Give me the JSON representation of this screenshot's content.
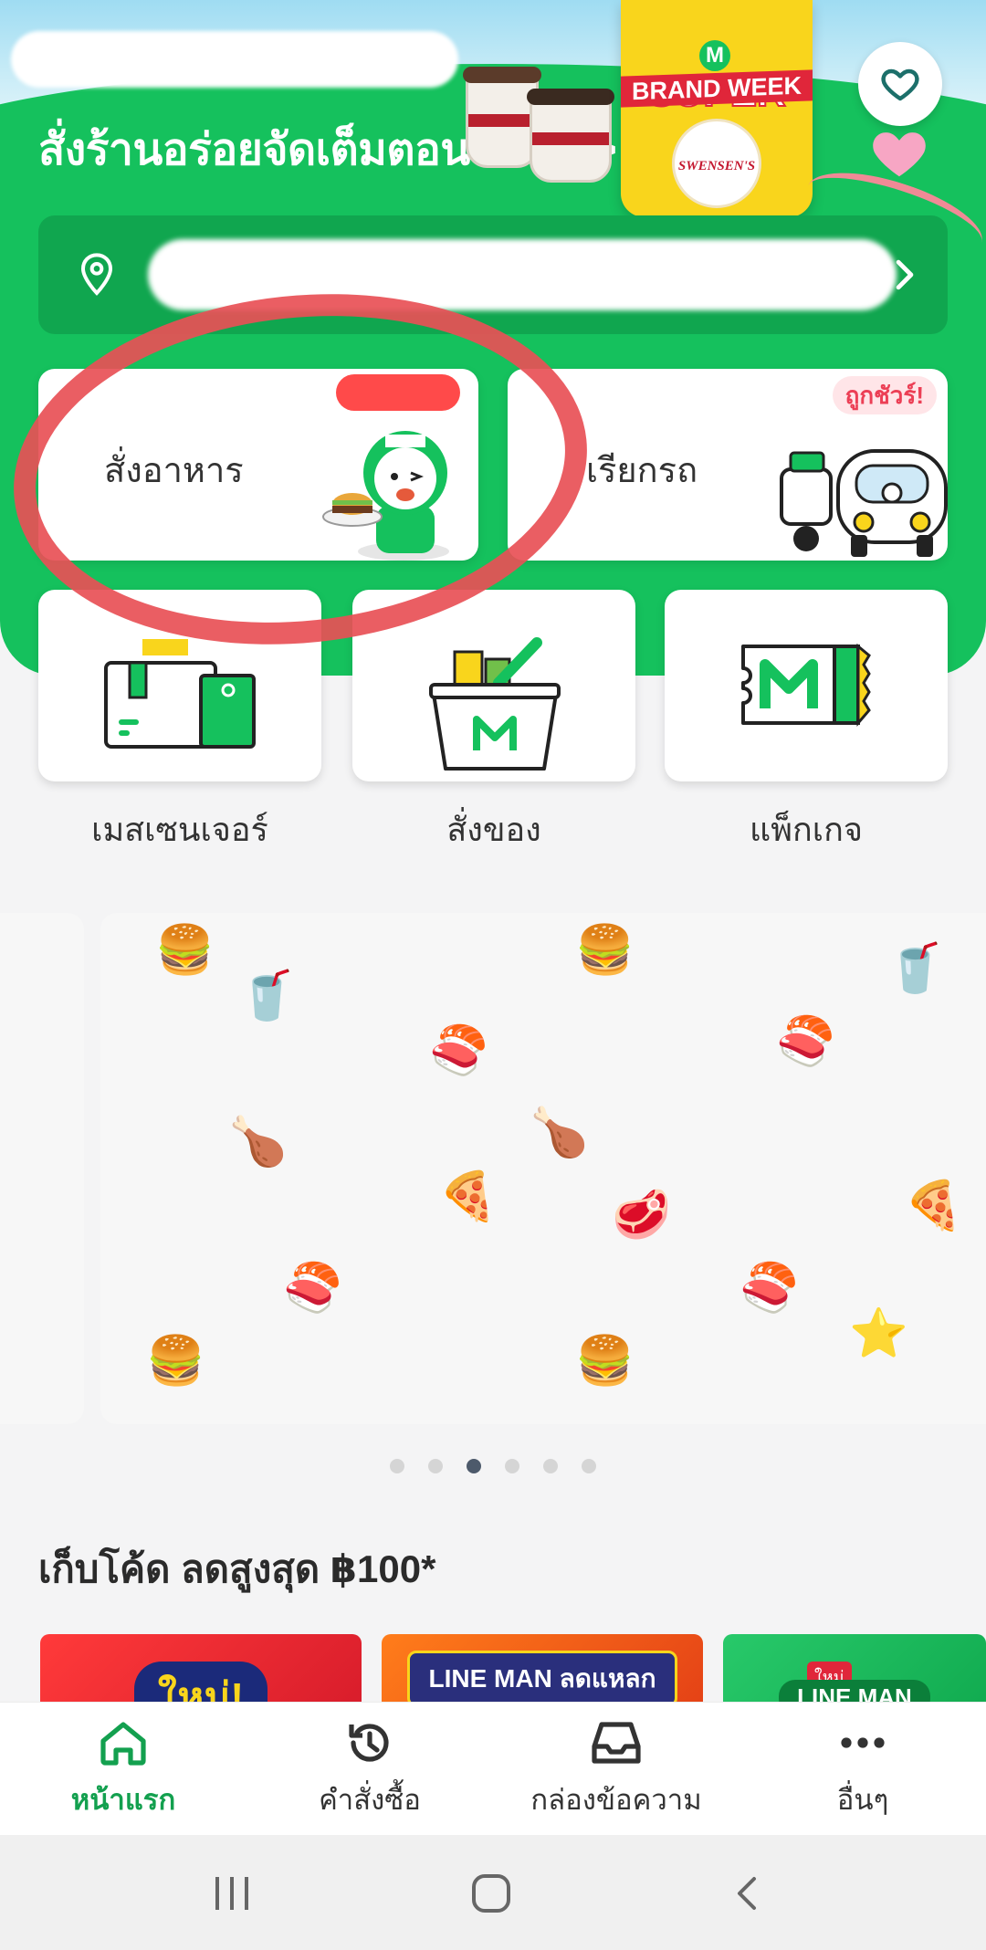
{
  "hero": {
    "headline": "สั่งร้านอร่อยจัดเต็มตอนนี้เลย! >",
    "promo": {
      "brand_mark": "M",
      "line1": "SUPER",
      "line2": "BRAND WEEK",
      "logo_text": "SWENSEN'S"
    },
    "favorite_icon": "heart-icon"
  },
  "address_bar": {
    "pin_icon": "location-pin-icon",
    "chevron_icon": "chevron-right-icon"
  },
  "services": [
    {
      "label": "สั่งอาหาร",
      "tag": "",
      "icon": "rider-with-burger"
    },
    {
      "label": "เรียกรถ",
      "tag": "ถูกชัวร์!",
      "icon": "motorbike-and-car"
    }
  ],
  "tiles": [
    {
      "label": "เมสเซนเจอร์",
      "icon": "parcel-icon"
    },
    {
      "label": "สั่งของ",
      "icon": "basket-icon"
    },
    {
      "label": "แพ็กเกจ",
      "icon": "ticket-icon"
    }
  ],
  "carousel": {
    "total": 6,
    "active_index": 2
  },
  "coupons": {
    "title": "เก็บโค้ด ลดสูงสุด ฿100*",
    "items": [
      {
        "text": "ใหม่!"
      },
      {
        "text": "LINE MAN ลดแหลก"
      },
      {
        "badge": "ใหม่",
        "text": "LINE MAN"
      }
    ]
  },
  "bottom_nav": [
    {
      "label": "หน้าแรก",
      "icon": "home-icon",
      "active": true
    },
    {
      "label": "คำสั่งซื้อ",
      "icon": "history-icon",
      "active": false
    },
    {
      "label": "กล่องข้อความ",
      "icon": "inbox-icon",
      "active": false
    },
    {
      "label": "อื่นๆ",
      "icon": "more-icon",
      "active": false
    }
  ],
  "colors": {
    "brand_green": "#15c15d",
    "dark_green": "#10a64f",
    "accent_red": "#ff4a4a",
    "active_nav": "#13a04f"
  }
}
